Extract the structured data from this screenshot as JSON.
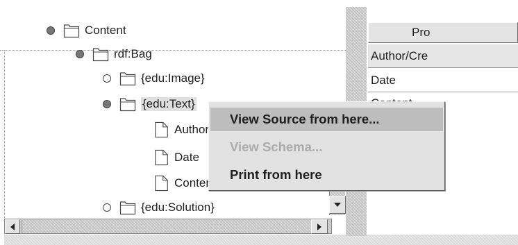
{
  "tree": {
    "nodes": [
      {
        "label": "Content",
        "kind": "folder",
        "bullet": "filled"
      },
      {
        "label": "rdf:Bag",
        "kind": "folder",
        "bullet": "filled"
      },
      {
        "label": "{edu:Image}",
        "kind": "folder",
        "bullet": "open"
      },
      {
        "label": "{edu:Text}",
        "kind": "folder",
        "bullet": "filled"
      },
      {
        "label": "Author/Creator",
        "kind": "file"
      },
      {
        "label": "Date",
        "kind": "file"
      },
      {
        "label": "Content",
        "kind": "file"
      },
      {
        "label": "{edu:Solution}",
        "kind": "folder",
        "bullet": "open"
      }
    ]
  },
  "properties": {
    "header": "Pro",
    "rows": [
      "Author/Cre",
      "Date",
      "Content"
    ]
  },
  "context_menu": {
    "items": [
      {
        "label": "View Source from here...",
        "state": "highlighted"
      },
      {
        "label": "View Schema...",
        "state": "disabled"
      },
      {
        "label": "Print from here",
        "state": "normal"
      }
    ]
  },
  "icons": {
    "folder": "folder-icon",
    "file": "document-icon",
    "scroll_down": "arrow-down-icon",
    "scroll_left": "arrow-left-icon",
    "scroll_right": "arrow-right-icon"
  },
  "colors": {
    "menu_bg": "#e2e2e2",
    "menu_highlight": "#bdbdbd",
    "disabled_text": "#ababab",
    "text": "#1e1e1e"
  }
}
